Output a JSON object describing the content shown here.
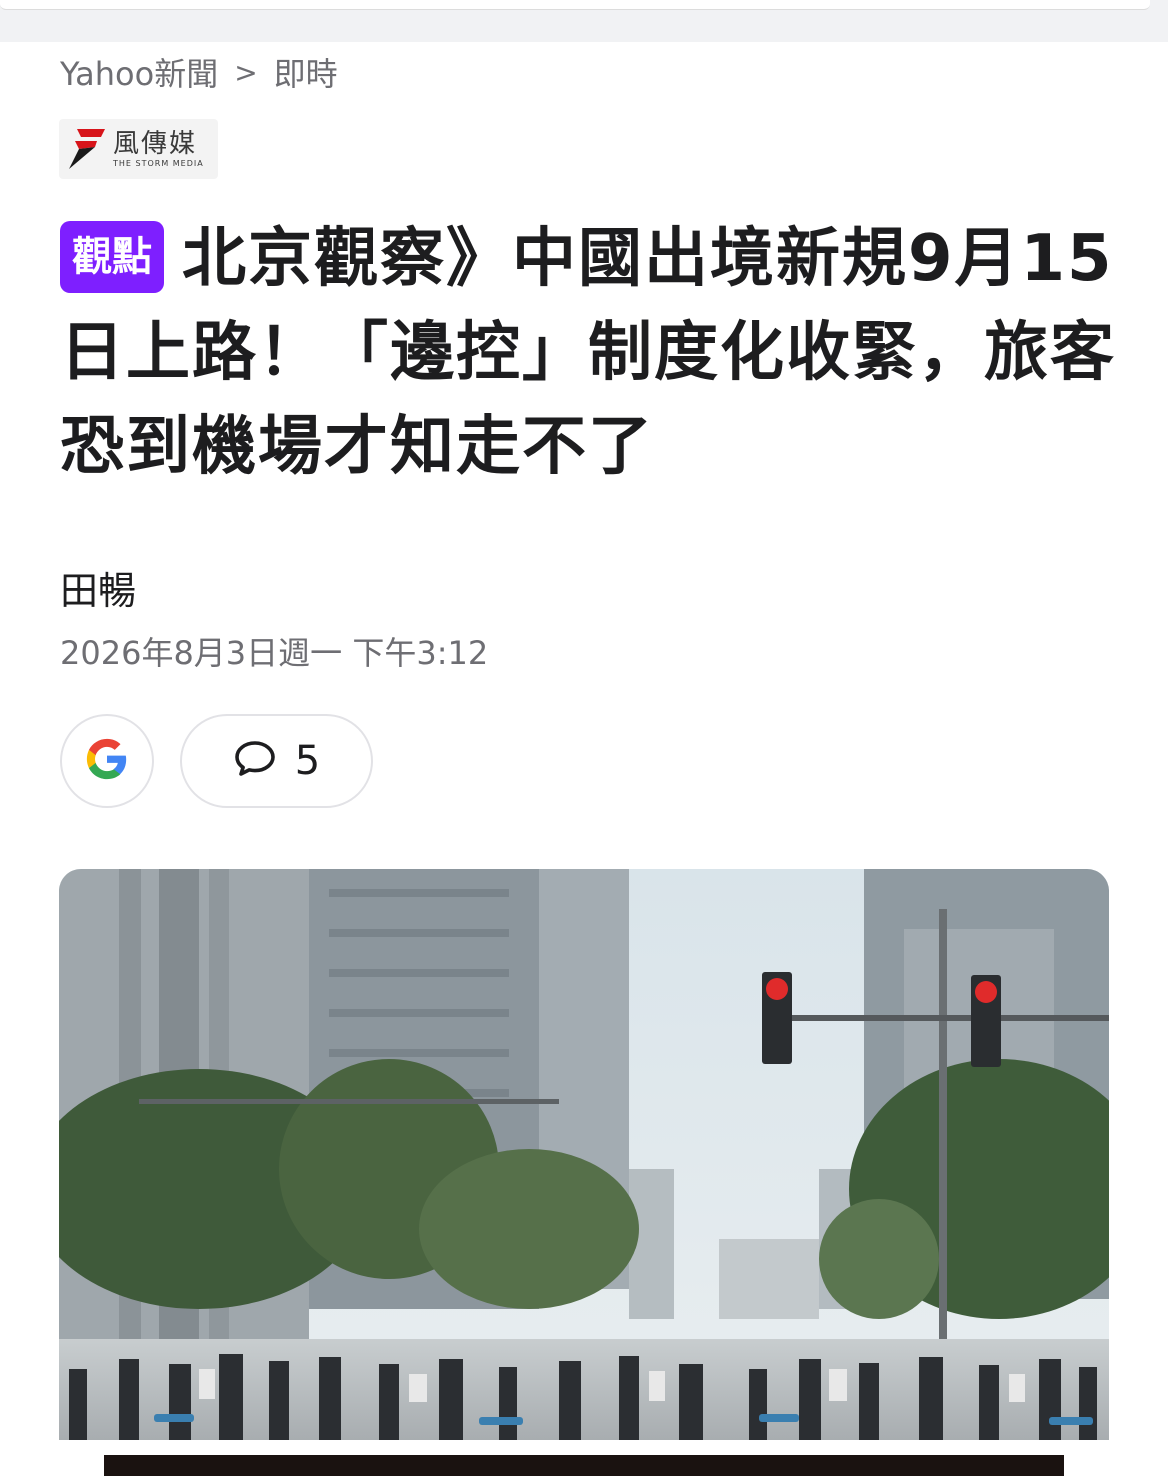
{
  "breadcrumb": {
    "site": "Yahoo新聞",
    "separator": ">",
    "section": "即時"
  },
  "publisher": {
    "name": "風傳媒",
    "name_en": "THE STORM MEDIA",
    "brand_color": "#d7141a"
  },
  "article": {
    "badge": "觀點",
    "badge_color": "#7e1fff",
    "headline": "北京觀察》中國出境新規9月15日上路！「邊控」制度化收緊，旅客恐到機場才知走不了",
    "author": "田暢",
    "date": "2026年8月3日週一 下午3:12"
  },
  "actions": {
    "google_icon": "google-icon",
    "comment_icon": "speech-bubble-icon",
    "comment_count": "5"
  },
  "media": {
    "photo_subject": "street-crossing-traffic-lights-photo"
  }
}
